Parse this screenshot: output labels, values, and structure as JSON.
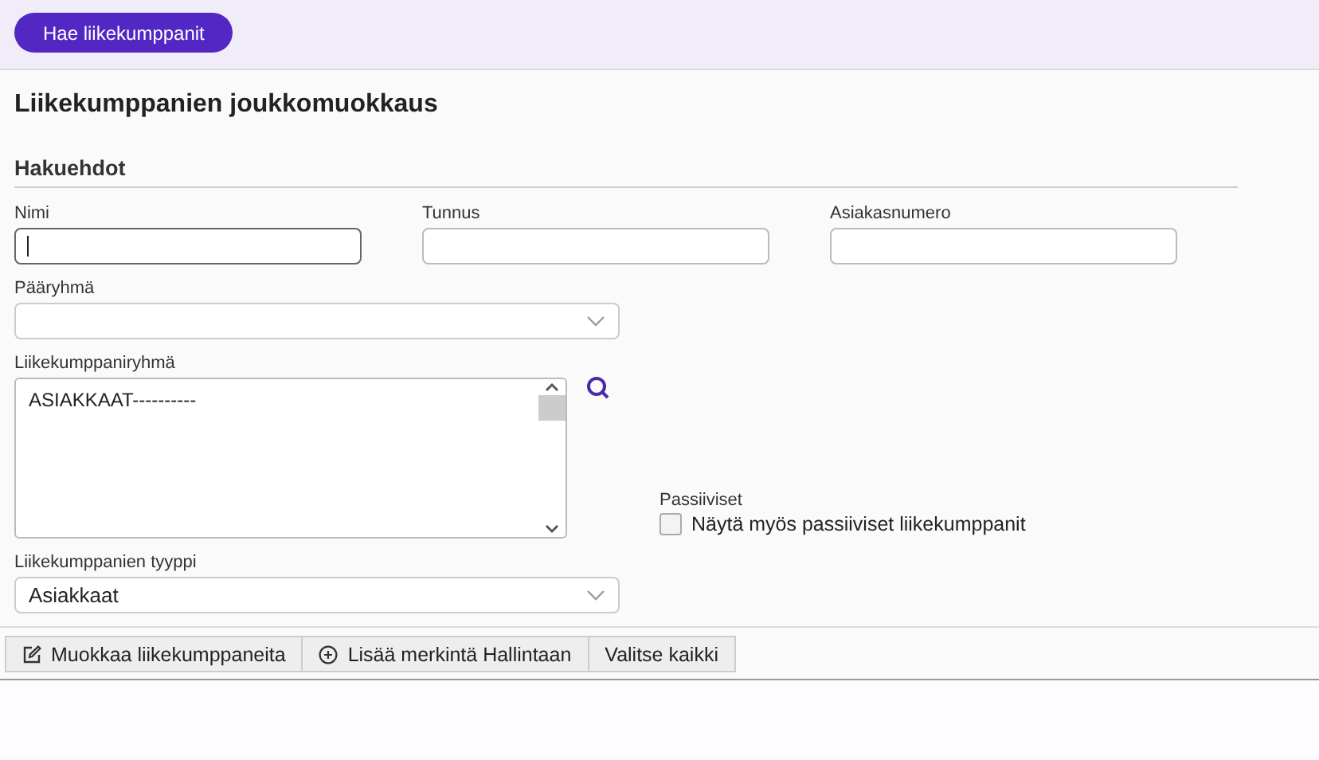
{
  "top_bar": {
    "search_button": "Hae liikekumppanit"
  },
  "title": "Liikekumppanien joukkomuokkaus",
  "section": {
    "title": "Hakuehdot"
  },
  "fields": [
    {
      "label": "Nimi",
      "focused": true
    },
    {
      "label": "Tunnus",
      "focused": false
    },
    {
      "label": "Asiakasnumero",
      "focused": false
    }
  ],
  "main_group": {
    "label": "Pääryhmä"
  },
  "partner_group": {
    "label": "Liikekumppaniryhmä",
    "items": [
      "ASIAKKAAT----------"
    ]
  },
  "passive": {
    "label": "Passiiviset",
    "checkbox": {
      "label": "Näytä myös passiiviset liikekumppanit",
      "checked": false
    }
  },
  "partner_type": {
    "label": "Liikekumppanien tyyppi",
    "value": "Asiakkaat"
  },
  "actions": [
    {
      "label": "Muokkaa liikekumppaneita",
      "kind": "edit"
    },
    {
      "label": "Lisää merkintä Hallintaan",
      "kind": "add"
    },
    {
      "label": "Valitse kaikki",
      "kind": "plain"
    }
  ]
}
